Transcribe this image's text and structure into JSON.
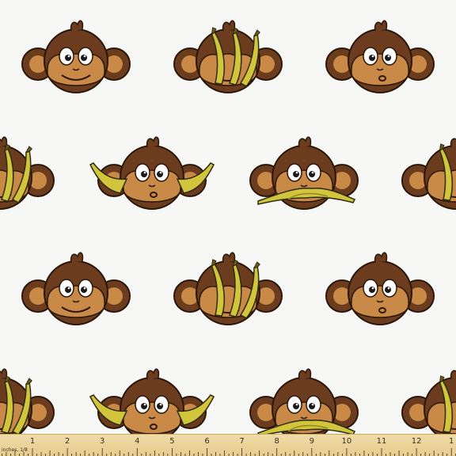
{
  "image": {
    "subject": "seamless fabric pattern of cartoon monkey faces",
    "colors": {
      "background": "#f7f7f5",
      "fur": "#6b3d1e",
      "fur_dark": "#3d200d",
      "face": "#c98a48",
      "banana": "#cfc23a",
      "banana_dark": "#8f8a22",
      "ruler": "#ecd69c"
    }
  },
  "ruler": {
    "unit_label": "inches, 1/8",
    "numbers": [
      "1",
      "2",
      "3",
      "4",
      "5",
      "6",
      "7",
      "8",
      "9",
      "10",
      "11",
      "12",
      "1"
    ]
  }
}
